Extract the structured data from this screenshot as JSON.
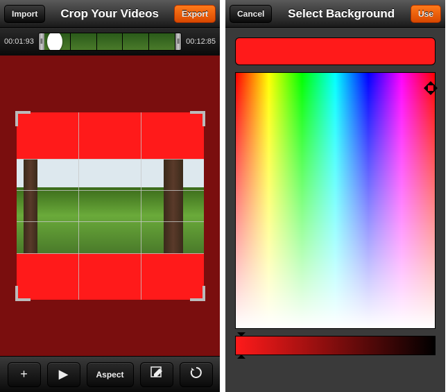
{
  "left": {
    "navbar": {
      "import_label": "Import",
      "title": "Crop Your Videos",
      "export_label": "Export"
    },
    "timeline": {
      "start_time": "00:01:93",
      "end_time": "00:12:85"
    },
    "toolbar": {
      "add_label": "+",
      "play_label": "▶",
      "aspect_label": "Aspect",
      "edit_label": "✎",
      "refresh_label": "↻"
    }
  },
  "right": {
    "navbar": {
      "cancel_label": "Cancel",
      "title": "Select Background",
      "use_label": "Use"
    },
    "color": {
      "selected_hex": "#ff1a1a"
    }
  }
}
